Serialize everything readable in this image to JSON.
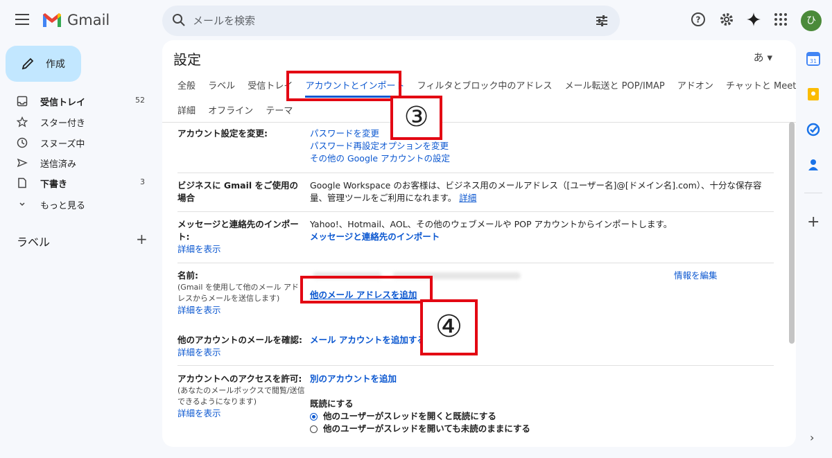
{
  "app": {
    "name": "Gmail",
    "search_placeholder": "メールを検索",
    "avatar_letter": "ひ"
  },
  "nav": {
    "compose": "作成",
    "items": [
      {
        "label": "受信トレイ",
        "count": "52"
      },
      {
        "label": "スター付き",
        "count": ""
      },
      {
        "label": "スヌーズ中",
        "count": ""
      },
      {
        "label": "送信済み",
        "count": ""
      },
      {
        "label": "下書き",
        "count": "3"
      },
      {
        "label": "もっと見る",
        "count": ""
      }
    ],
    "labels_heading": "ラベル",
    "labels_add": "+"
  },
  "settings": {
    "title": "設定",
    "lang_icon": "あ",
    "tabs_row1": [
      "全般",
      "ラベル",
      "受信トレイ",
      "アカウントとインポート",
      "フィルタとブロック中のアドレス",
      "メール転送と POP/IMAP",
      "アドオン",
      "チャットと Meet"
    ],
    "tabs_row2": [
      "詳細",
      "オフライン",
      "テーマ"
    ],
    "rows": {
      "account": {
        "label": "アカウント設定を変更:",
        "links": [
          "パスワードを変更",
          "パスワード再設定オプションを変更",
          "その他の Google アカウントの設定"
        ]
      },
      "business": {
        "label": "ビジネスに Gmail をご使用の場合",
        "text": "Google Workspace のお客様は、ビジネス用のメールアドレス（[ユーザー名]@[ドメイン名].com）、十分な保存容量、管理ツールをご利用になれます。",
        "link": "詳細"
      },
      "import": {
        "label": "メッセージと連絡先のインポート:",
        "more": "詳細を表示",
        "text": "Yahoo!、Hotmail、AOL、その他のウェブメールや POP アカウントからインポートします。",
        "link": "メッセージと連絡先のインポート"
      },
      "name": {
        "label": "名前:",
        "note": "(Gmail を使用して他のメール アドレスからメールを送信します)",
        "more": "詳細を表示",
        "edit": "情報を編集",
        "add": "他のメール アドレスを追加"
      },
      "check": {
        "label": "他のアカウントのメールを確認:",
        "more": "詳細を表示",
        "link": "メール アカウントを追加する"
      },
      "access": {
        "label": "アカウントへのアクセスを許可:",
        "note": "(あなたのメールボックスで閲覧/送信できるようになります)",
        "more": "詳細を表示",
        "link": "別のアカウントを追加",
        "read_heading": "既読にする",
        "opt1": "他のユーザーがスレッドを開くと既読にする",
        "opt2": "他のユーザーがスレッドを開いても未読のままにする"
      }
    }
  },
  "annotations": {
    "step3": "③",
    "step4": "④",
    "highlight_color": "#e30613"
  },
  "colors": {
    "accent": "#0b57d0",
    "compose_bg": "#c2e7ff",
    "avatar": "#4b8a3a"
  }
}
